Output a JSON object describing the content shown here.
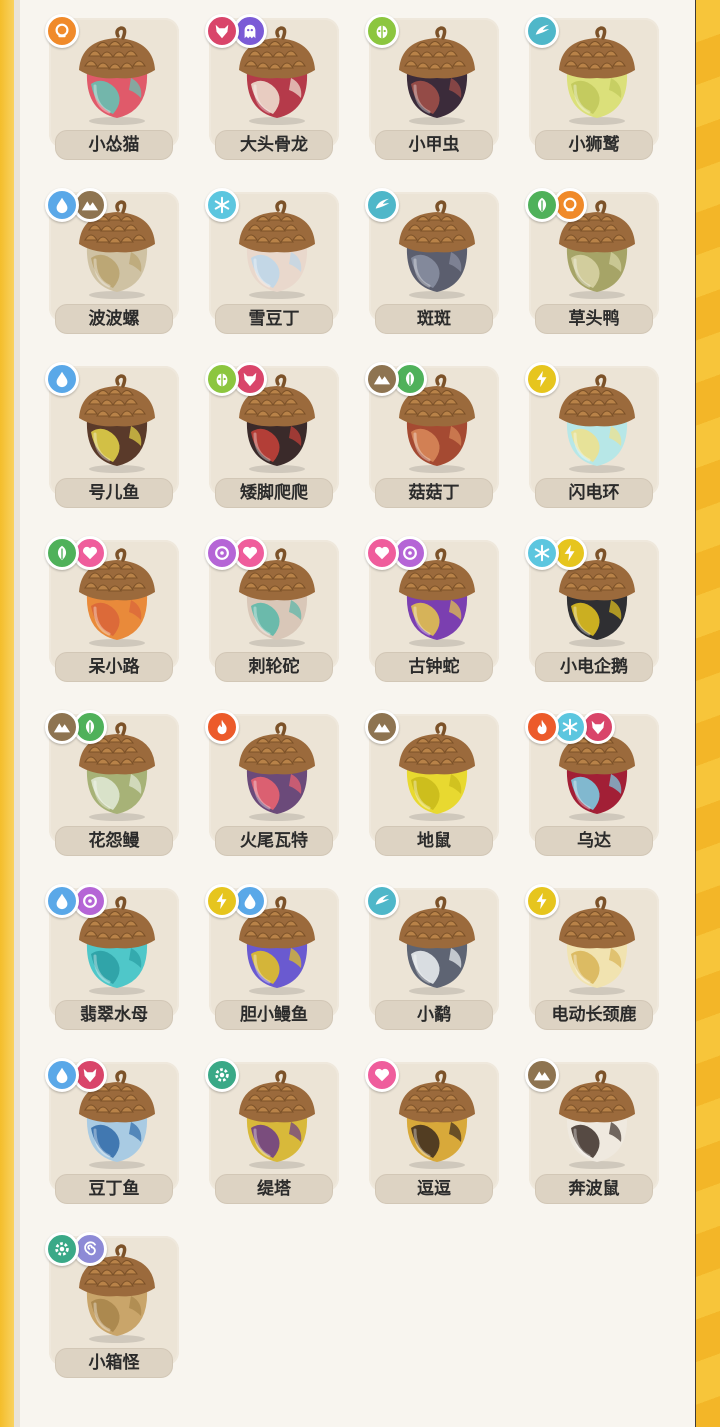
{
  "colors": {
    "normal": "#f08a2a",
    "fire": "#ec5b2b",
    "water": "#5aa8e8",
    "grass": "#4fb15a",
    "ice": "#5cc6df",
    "electric": "#e6c51e",
    "ground": "#8e7451",
    "flying": "#4fb7c9",
    "bug": "#8cc63f",
    "ghost": "#7b5bd6",
    "dark": "#d9456a",
    "fairy": "#ef5d9c",
    "psychic": "#b565d6",
    "mechanical": "#3aa987",
    "illusion": "#8d8ad6"
  },
  "creatures": [
    {
      "name": "小怂猫",
      "types": [
        "normal"
      ],
      "body": [
        "#e05a6a",
        "#5fc7b6"
      ]
    },
    {
      "name": "大头骨龙",
      "types": [
        "dark",
        "ghost"
      ],
      "body": [
        "#b53a4a",
        "#f1e6d6"
      ]
    },
    {
      "name": "小甲虫",
      "types": [
        "bug"
      ],
      "body": [
        "#3b2b3a",
        "#a5514a"
      ]
    },
    {
      "name": "小狮鹫",
      "types": [
        "flying"
      ],
      "body": [
        "#dbe07a",
        "#bfc75a"
      ]
    },
    {
      "name": "波波螺",
      "types": [
        "water",
        "ground"
      ],
      "body": [
        "#cfc2a3",
        "#b8a26d"
      ]
    },
    {
      "name": "雪豆丁",
      "types": [
        "ice"
      ],
      "body": [
        "#e9d8cc",
        "#bcd7ea"
      ]
    },
    {
      "name": "斑斑",
      "types": [
        "flying"
      ],
      "body": [
        "#5b5e6e",
        "#8b90a3"
      ]
    },
    {
      "name": "草头鸭",
      "types": [
        "grass",
        "normal"
      ],
      "body": [
        "#a6a467",
        "#d9d5a7"
      ]
    },
    {
      "name": "号儿鱼",
      "types": [
        "water"
      ],
      "body": [
        "#5a3a2a",
        "#e8d84a"
      ]
    },
    {
      "name": "矮脚爬爬",
      "types": [
        "bug",
        "dark"
      ],
      "body": [
        "#3a2a2a",
        "#c9423a"
      ]
    },
    {
      "name": "菇菇丁",
      "types": [
        "ground",
        "grass"
      ],
      "body": [
        "#a54a32",
        "#d98a5a"
      ]
    },
    {
      "name": "闪电环",
      "types": [
        "electric"
      ],
      "body": [
        "#b7e7e7",
        "#f0e18a"
      ]
    },
    {
      "name": "呆小路",
      "types": [
        "grass",
        "fairy"
      ],
      "body": [
        "#e98a3a",
        "#d9643a"
      ]
    },
    {
      "name": "刺轮砣",
      "types": [
        "psychic",
        "fairy"
      ],
      "body": [
        "#d9c7b8",
        "#57b7a8"
      ]
    },
    {
      "name": "古钟蛇",
      "types": [
        "fairy",
        "psychic"
      ],
      "body": [
        "#7b3fb0",
        "#e6c84a"
      ]
    },
    {
      "name": "小电企鹅",
      "types": [
        "ice",
        "electric"
      ],
      "body": [
        "#2f2f32",
        "#e6c51e"
      ]
    },
    {
      "name": "花怨鳗",
      "types": [
        "ground",
        "grass"
      ],
      "body": [
        "#a7b277",
        "#e2ead7"
      ]
    },
    {
      "name": "火尾瓦特",
      "types": [
        "fire"
      ],
      "body": [
        "#6b4a7a",
        "#ee6470"
      ]
    },
    {
      "name": "地鼠",
      "types": [
        "ground"
      ],
      "body": [
        "#e8d930",
        "#c8b81a"
      ]
    },
    {
      "name": "乌达",
      "types": [
        "fire",
        "ice",
        "dark"
      ],
      "body": [
        "#a21f36",
        "#7bd4ea"
      ]
    },
    {
      "name": "翡翠水母",
      "types": [
        "water",
        "psychic"
      ],
      "body": [
        "#4fc7c9",
        "#2a9ea3"
      ]
    },
    {
      "name": "胆小鳗鱼",
      "types": [
        "electric",
        "water"
      ],
      "body": [
        "#6a5ad0",
        "#e6c51e"
      ]
    },
    {
      "name": "小鹬",
      "types": [
        "flying"
      ],
      "body": [
        "#5e6473",
        "#eef2f5"
      ]
    },
    {
      "name": "电动长颈鹿",
      "types": [
        "electric"
      ],
      "body": [
        "#f1e3b0",
        "#d8b456"
      ]
    },
    {
      "name": "豆丁鱼",
      "types": [
        "water",
        "dark"
      ],
      "body": [
        "#a9cbe3",
        "#2f6aa8"
      ]
    },
    {
      "name": "缇塔",
      "types": [
        "mechanical"
      ],
      "body": [
        "#d8b93a",
        "#6a3a8a"
      ]
    },
    {
      "name": "逗逗",
      "types": [
        "fairy"
      ],
      "body": [
        "#d8a93a",
        "#3b2a1e"
      ]
    },
    {
      "name": "奔波鼠",
      "types": [
        "ground"
      ],
      "body": [
        "#efe9df",
        "#3b2e28"
      ]
    },
    {
      "name": "小箱怪",
      "types": [
        "mechanical",
        "illusion"
      ],
      "body": [
        "#c9a56a",
        "#a7844a"
      ]
    }
  ]
}
